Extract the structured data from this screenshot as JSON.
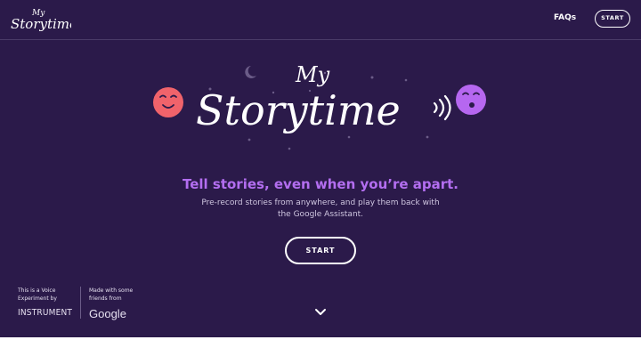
{
  "header": {
    "brand_small": "My",
    "brand_large": "Storytime",
    "faq_label": "FAQs",
    "start_label": "START"
  },
  "hero": {
    "logo_small": "My",
    "logo_large": "Storytime",
    "tagline": "Tell stories, even when you’re apart.",
    "subtitle": "Pre-record stories from anywhere, and play them back with the Google Assistant.",
    "start_label": "START"
  },
  "credits": {
    "voice_experiment": "This is a Voice Experiment by",
    "instrument": "INSTRUMENT",
    "made_with": "Made with some friends from",
    "google": "Google"
  },
  "colors": {
    "background": "#2b1a4a",
    "accent_purple": "#b36ef0",
    "face_red": "#f0636b",
    "face_purple": "#b667f0"
  },
  "icons": [
    "chevron-down-icon",
    "moon-icon",
    "sound-waves-icon"
  ]
}
